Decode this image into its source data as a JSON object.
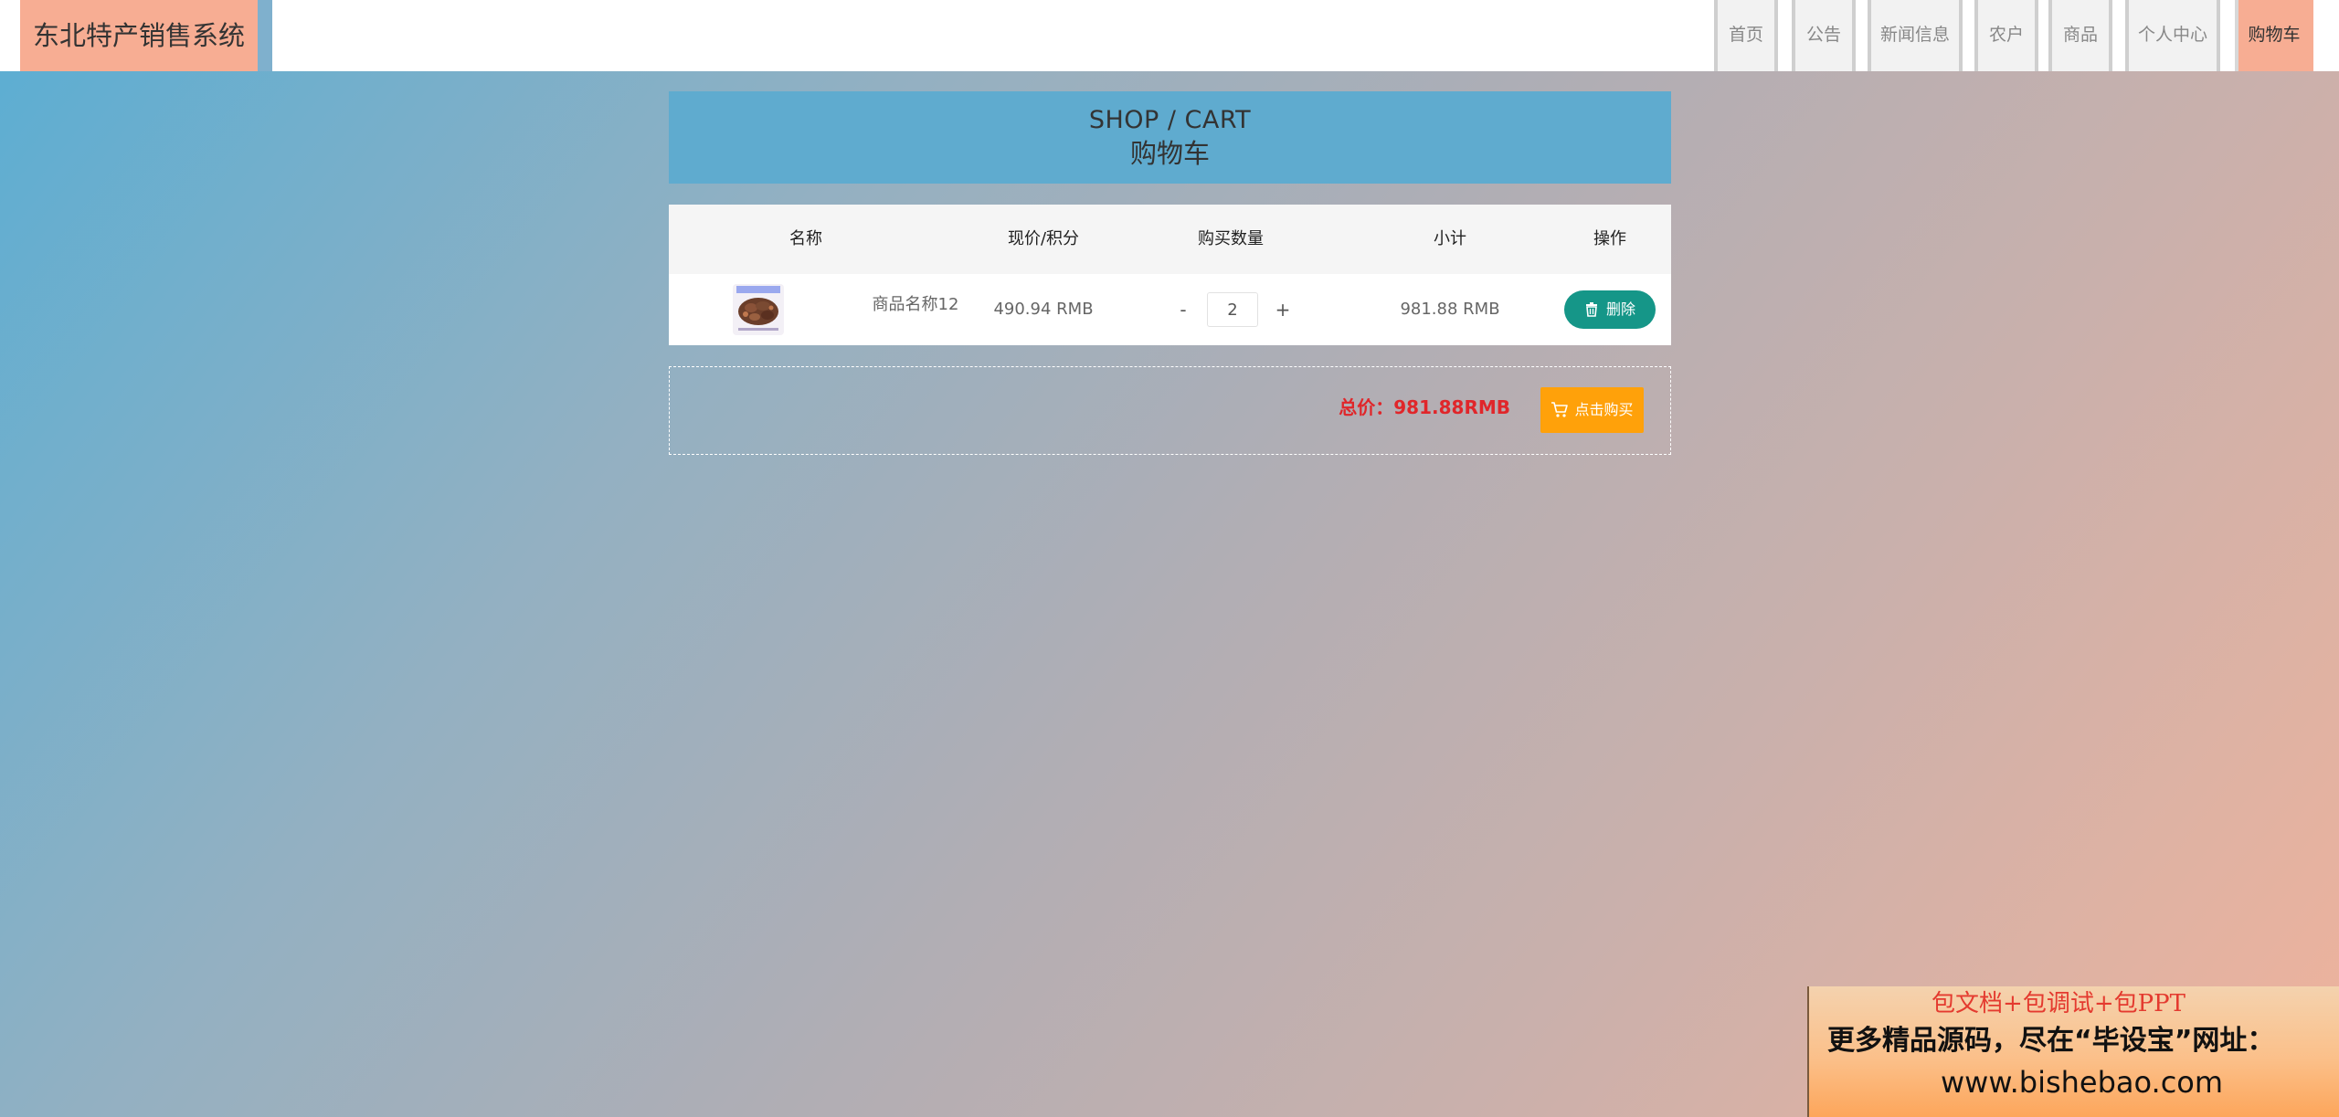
{
  "header": {
    "brand": "东北特产销售系统",
    "nav": [
      {
        "label": "首页"
      },
      {
        "label": "公告"
      },
      {
        "label": "新闻信息"
      },
      {
        "label": "农户"
      },
      {
        "label": "商品"
      },
      {
        "label": "个人中心"
      },
      {
        "label": "购物车",
        "active": true
      }
    ]
  },
  "banner": {
    "title_en": "SHOP / CART",
    "title_cn": "购物车"
  },
  "cart": {
    "columns": [
      "名称",
      "现价/积分",
      "购买数量",
      "小计",
      "操作"
    ],
    "rows": [
      {
        "name": "商品名称12",
        "price": "490.94 RMB",
        "quantity": "2",
        "subtotal": "981.88 RMB",
        "delete_label": "删除",
        "decrement_label": "-",
        "increment_label": "+"
      }
    ]
  },
  "summary": {
    "total": "总价：981.88RMB",
    "buy_label": "点击购买"
  },
  "ad": {
    "line1": "包文档+包调试+包PPT",
    "line2": "更多精品源码，尽在“毕设宝”网址：",
    "line3": "www.bishebao.com"
  },
  "colors": {
    "brand_bg": "#f7ad93",
    "banner_bg": "#5fabcf",
    "delete_button": "#159688",
    "buy_button": "#ffa10a",
    "total_text": "#e0262a"
  }
}
